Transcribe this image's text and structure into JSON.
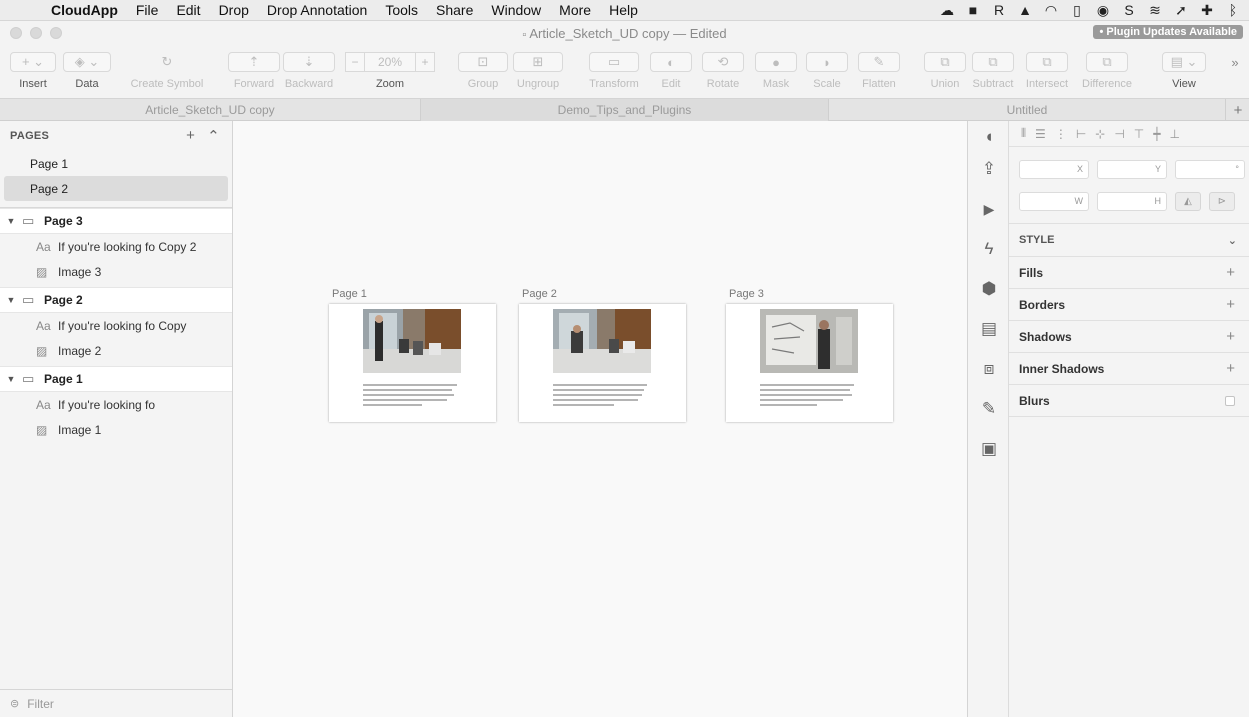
{
  "menubar": {
    "app": "CloudApp",
    "items": [
      "File",
      "Edit",
      "Drop",
      "Drop Annotation",
      "Tools",
      "Share",
      "Window",
      "More",
      "Help"
    ]
  },
  "window": {
    "title": "Article_Sketch_UD copy",
    "edited": "— Edited",
    "plugin_badge": "• Plugin Updates Available"
  },
  "toolbar": {
    "insert": "Insert",
    "data": "Data",
    "create_symbol": "Create Symbol",
    "forward": "Forward",
    "backward": "Backward",
    "zoom": "Zoom",
    "zoom_value": "20%",
    "group": "Group",
    "ungroup": "Ungroup",
    "transform": "Transform",
    "edit": "Edit",
    "rotate": "Rotate",
    "mask": "Mask",
    "scale": "Scale",
    "flatten": "Flatten",
    "union": "Union",
    "subtract": "Subtract",
    "intersect": "Intersect",
    "difference": "Difference",
    "view": "View"
  },
  "tabs": [
    "Article_Sketch_UD copy",
    "Demo_Tips_and_Plugins",
    "Untitled"
  ],
  "sidebar": {
    "pages_header": "PAGES",
    "pages": [
      "Page 1",
      "Page 2"
    ],
    "selected_page": "Page 2",
    "artboards": [
      {
        "name": "Page 3",
        "layers": [
          {
            "type": "text",
            "name": "If you're looking fo Copy 2"
          },
          {
            "type": "image",
            "name": "Image 3"
          }
        ]
      },
      {
        "name": "Page 2",
        "layers": [
          {
            "type": "text",
            "name": "If you're looking fo Copy"
          },
          {
            "type": "image",
            "name": "Image 2"
          }
        ]
      },
      {
        "name": "Page 1",
        "layers": [
          {
            "type": "text",
            "name": "If you're looking fo"
          },
          {
            "type": "image",
            "name": "Image 1"
          }
        ]
      }
    ],
    "filter_placeholder": "Filter"
  },
  "canvas": {
    "artboards": [
      "Page 1",
      "Page 2",
      "Page 3"
    ]
  },
  "inspector": {
    "x_label": "X",
    "y_label": "Y",
    "rotation_label": "°",
    "w_label": "W",
    "h_label": "H",
    "style_header": "STYLE",
    "sections": [
      "Fills",
      "Borders",
      "Shadows",
      "Inner Shadows",
      "Blurs"
    ]
  }
}
